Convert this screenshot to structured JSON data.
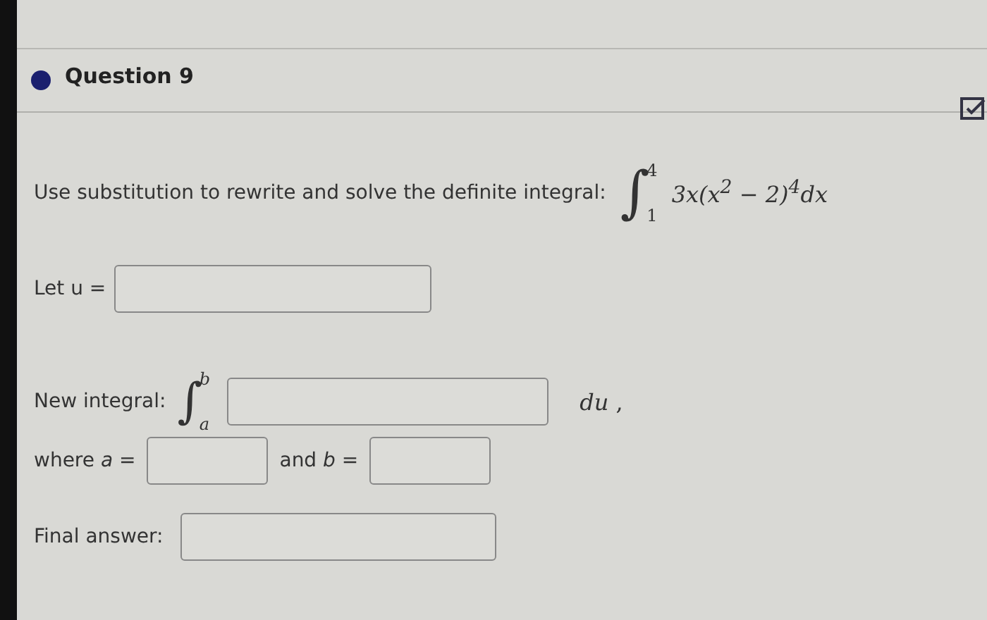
{
  "question": {
    "title": "Question 9",
    "prompt": "Use substitution to rewrite and solve the definite integral:",
    "integral": {
      "sign": "∫",
      "upper": "4",
      "lower": "1",
      "integrand": "3x(x$^{2}$ − 2)$^{4}$dx"
    }
  },
  "let_u": {
    "label": "Let  u ="
  },
  "new_integral": {
    "label": "New integral:",
    "sign": "∫",
    "upper": "b",
    "lower": "a",
    "suffix": "*du* ,"
  },
  "limits": {
    "label_a": "where *a* =",
    "label_b": "and *b* ="
  },
  "final": {
    "label": "Final answer:"
  }
}
